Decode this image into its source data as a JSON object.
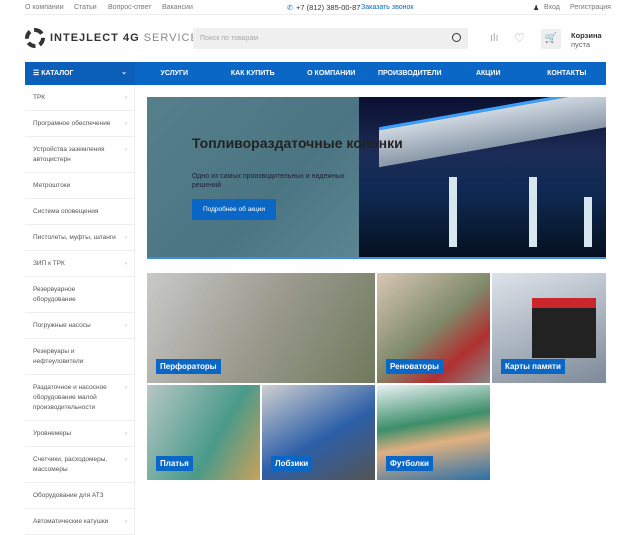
{
  "topbar": {
    "links": [
      "О компании",
      "Статьи",
      "Вопрос-ответ",
      "Вакансии"
    ],
    "phone": "+7 (812) 385-00-87",
    "callback": "Заказать звонок",
    "login": "Вход",
    "register": "Регистрация"
  },
  "header": {
    "logo_bold": "INTEJLECT 4G",
    "logo_light": "SERVICE",
    "search_placeholder": "Поиск по товарам",
    "cart_title": "Корзина",
    "cart_status": "пуста"
  },
  "nav": {
    "catalog": "КАТАЛОГ",
    "items": [
      "УСЛУГИ",
      "КАК КУПИТЬ",
      "О КОМПАНИИ",
      "ПРОИЗВОДИТЕЛИ",
      "АКЦИИ",
      "КОНТАКТЫ"
    ]
  },
  "sidebar": [
    {
      "label": "ТРК",
      "arrow": true
    },
    {
      "label": "Програмное обеспечение",
      "arrow": true
    },
    {
      "label": "Устройства заземления автоцистерн",
      "arrow": true
    },
    {
      "label": "Метроштоки",
      "arrow": false
    },
    {
      "label": "Система оповещения",
      "arrow": false
    },
    {
      "label": "Пистолеты, муфты, шланги",
      "arrow": true
    },
    {
      "label": "ЗИП к ТРК",
      "arrow": true
    },
    {
      "label": "Резервуарное оборудование",
      "arrow": false
    },
    {
      "label": "Погружные насосы",
      "arrow": true
    },
    {
      "label": "Резервуары и нефтеуловители",
      "arrow": false
    },
    {
      "label": "Раздаточное и насосное оборудование малой производительности",
      "arrow": true
    },
    {
      "label": "Уровнемеры",
      "arrow": true
    },
    {
      "label": "Счетчики, расходомеры, массомеры",
      "arrow": true
    },
    {
      "label": "Оборудование для АТЗ",
      "arrow": false
    },
    {
      "label": "Автоматические катушки",
      "arrow": true
    }
  ],
  "banner": {
    "title": "Топливораздаточные колонки",
    "subtitle": "Одно из самых производительных и надежных решений",
    "button": "Подробнее об акции"
  },
  "tiles": [
    "Перфораторы",
    "Реноваторы",
    "Карты памяти",
    "Платья",
    "Лобзики",
    "Футболки"
  ],
  "colors": {
    "accent": "#0a67c6"
  }
}
